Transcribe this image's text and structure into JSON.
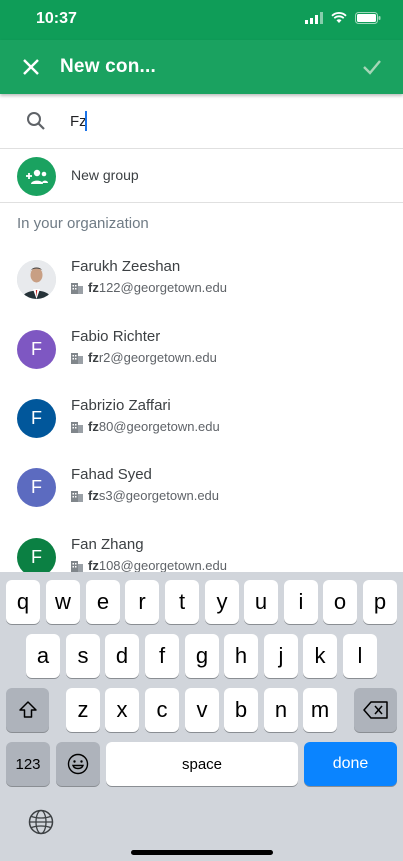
{
  "status_bar": {
    "time": "10:37"
  },
  "app_bar": {
    "title": "New con..."
  },
  "search": {
    "query": "Fz"
  },
  "new_group": {
    "label": "New group"
  },
  "section": {
    "header": "In your organization"
  },
  "contacts": [
    {
      "name": "Farukh Zeeshan",
      "email_bold": "fz",
      "email_rest": "122@georgetown.edu",
      "avatar_type": "photo",
      "color": "#cfd8dc"
    },
    {
      "name": "Fabio Richter",
      "email_bold": "fz",
      "email_rest": "r2@georgetown.edu",
      "avatar_letter": "F",
      "color": "#7e57c2"
    },
    {
      "name": "Fabrizio Zaffari",
      "email_bold": "fz",
      "email_rest": "80@georgetown.edu",
      "avatar_letter": "F",
      "color": "#01579b"
    },
    {
      "name": "Fahad Syed",
      "email_bold": "fz",
      "email_rest": "s3@georgetown.edu",
      "avatar_letter": "F",
      "color": "#5c6bc0"
    },
    {
      "name": "Fan Zhang",
      "email_bold": "fz",
      "email_rest": "108@georgetown.edu",
      "avatar_letter": "F",
      "color": "#0b8043"
    }
  ],
  "keyboard": {
    "row1": [
      "q",
      "w",
      "e",
      "r",
      "t",
      "y",
      "u",
      "i",
      "o",
      "p"
    ],
    "row2": [
      "a",
      "s",
      "d",
      "f",
      "g",
      "h",
      "j",
      "k",
      "l"
    ],
    "row3": [
      "z",
      "x",
      "c",
      "v",
      "b",
      "n",
      "m"
    ],
    "numbers_label": "123",
    "space_label": "space",
    "done_label": "done"
  },
  "colors": {
    "app_bar": "#1aa260",
    "status_bar": "#0f9d58",
    "done_key": "#0a84ff"
  }
}
